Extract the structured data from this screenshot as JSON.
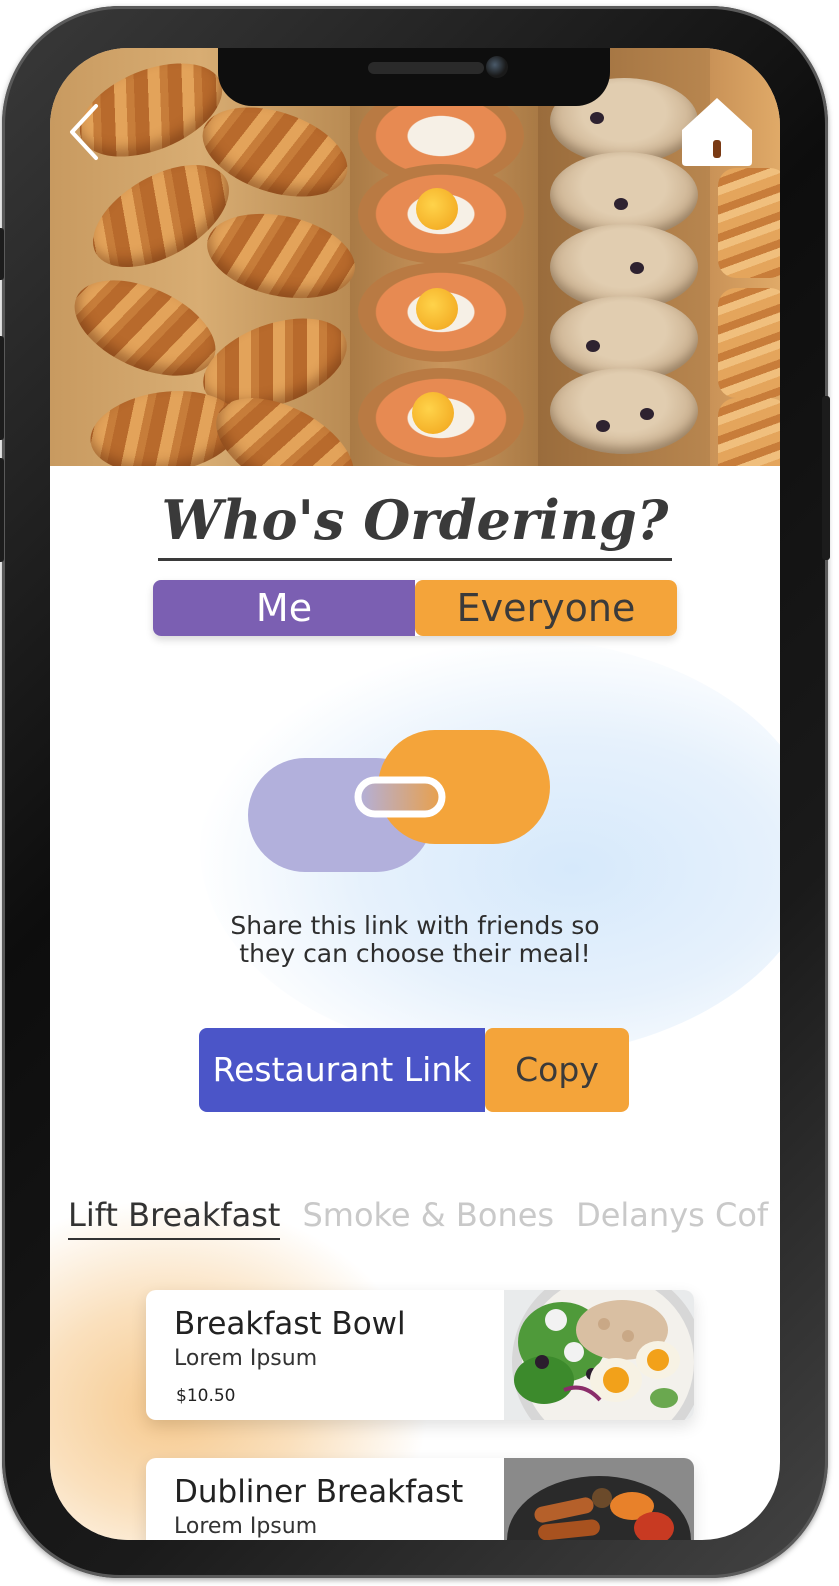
{
  "nav": {
    "back_icon": "chevron-left-icon",
    "home_icon": "home-icon"
  },
  "heading": "Who's Ordering?",
  "segment": {
    "me_label": "Me",
    "everyone_label": "Everyone",
    "selected": "Everyone"
  },
  "share": {
    "text": "Share this link with friends so they can choose their meal!"
  },
  "link_bar": {
    "label": "Restaurant Link",
    "copy_label": "Copy"
  },
  "restaurants": [
    {
      "label": "Lift Breakfast",
      "active": true
    },
    {
      "label": "Smoke & Bones",
      "active": false
    },
    {
      "label": "Delanys Cof",
      "active": false
    }
  ],
  "menu": [
    {
      "title": "Breakfast Bowl",
      "subtitle": "Lorem Ipsum",
      "price": "$10.50"
    },
    {
      "title": "Dubliner Breakfast",
      "subtitle": "Lorem Ipsum",
      "price": ""
    }
  ],
  "colors": {
    "purple": "#7b5fb2",
    "orange": "#f4a43a",
    "blue": "#4b55c8",
    "lavender": "#b2b0dc"
  }
}
